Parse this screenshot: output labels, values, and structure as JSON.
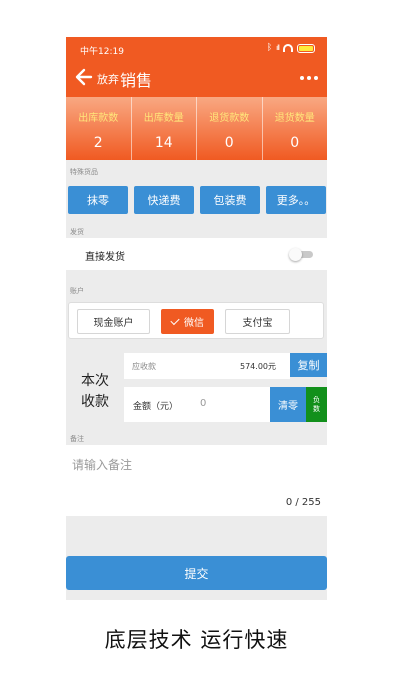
{
  "status_bar": {
    "time": "中午12:19",
    "bluetooth_icon": "ᛒ",
    "signal_icon": "ıll",
    "battery_color": "#ffeb3b"
  },
  "app_bar": {
    "back_label": "放弃",
    "title": "销售",
    "more_icon": "more-vertical-icon"
  },
  "stats": [
    {
      "label": "出库款数",
      "value": "2"
    },
    {
      "label": "出库数量",
      "value": "14"
    },
    {
      "label": "退货款数",
      "value": "0"
    },
    {
      "label": "退货数量",
      "value": "0"
    }
  ],
  "special_goods": {
    "label": "特殊货品",
    "buttons": [
      "抹零",
      "快递费",
      "包装费",
      "更多。。"
    ]
  },
  "shipping": {
    "label": "发货",
    "direct_ship_label": "直接发货",
    "direct_ship_on": false
  },
  "account": {
    "label": "账户",
    "options": [
      "现金账户",
      "微信",
      "支付宝"
    ],
    "selected": "微信"
  },
  "payment": {
    "side_label_line1": "本次",
    "side_label_line2": "收款",
    "receivable_label": "应收款",
    "receivable_value": "574.00元",
    "copy_label": "复制",
    "amount_label": "金额（元）",
    "amount_placeholder": "0",
    "clear_label": "清零",
    "negative_label": "负数"
  },
  "remark": {
    "label": "备注",
    "placeholder": "请输入备注",
    "counter": "0 / 255"
  },
  "submit_label": "提交",
  "caption": "底层技术  运行快速",
  "colors": {
    "primary": "#f05a22",
    "button_blue": "#3a8fd5",
    "negative_green": "#12901b",
    "stat_label": "#ffe67a"
  }
}
